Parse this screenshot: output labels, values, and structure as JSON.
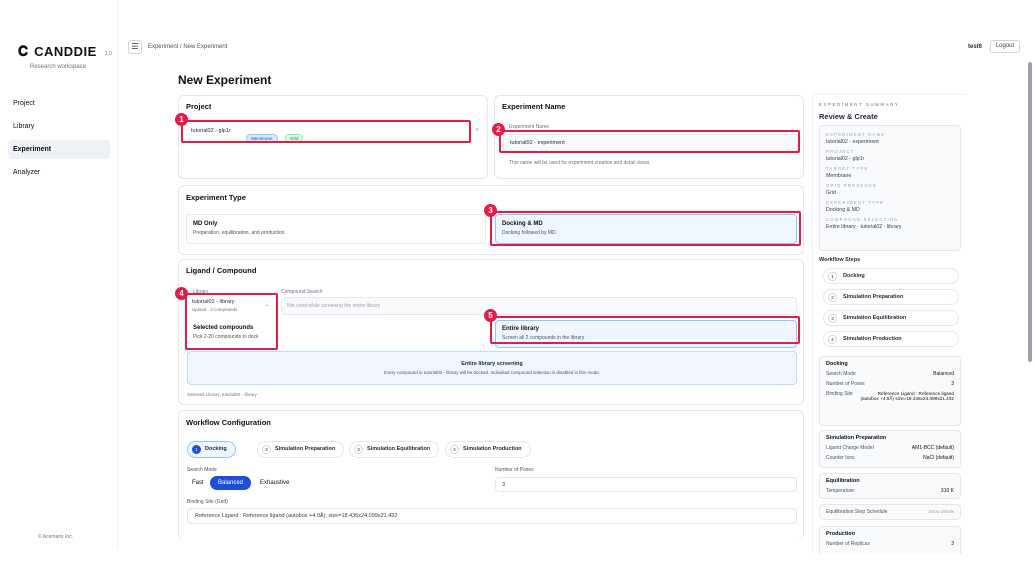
{
  "brand": {
    "name": "CANDDIE",
    "version": "2.0",
    "workspace": "Research workspace",
    "logo_icon": "c-logo-icon"
  },
  "nav": {
    "items": [
      {
        "label": "Project",
        "active": false
      },
      {
        "label": "Library",
        "active": false
      },
      {
        "label": "Experiment",
        "active": true
      },
      {
        "label": "Analyzer",
        "active": false
      }
    ]
  },
  "footer": {
    "copyright": "© Acemarix Inc."
  },
  "topbar": {
    "breadcrumb": "Experiment / New Experiment",
    "user": "test6",
    "logout": "Logout",
    "menu_icon": "hamburger-icon"
  },
  "page": {
    "title": "New Experiment"
  },
  "project": {
    "title": "Project",
    "value": "tutorial02 - glp1r",
    "tags": [
      "Membrane",
      "Grid"
    ],
    "clear_icon": "×"
  },
  "exp_name": {
    "title": "Experiment Name",
    "label": "Experiment Name",
    "value": "tutorial02 - experiment",
    "help": "This name will be used for experiment creation and detail views."
  },
  "exp_type": {
    "title": "Experiment Type",
    "options": [
      {
        "title": "MD Only",
        "desc": "Preparation, equilibration, and production."
      },
      {
        "title": "Docking & MD",
        "desc": "Docking followed by MD."
      }
    ]
  },
  "ligand": {
    "title": "Ligand / Compound",
    "library_label": "Library",
    "library_value": "tutorial02 - library",
    "library_sub": "Upload · 2 compounds",
    "search_label": "Compound Search",
    "search_placeholder": "Not used while screening the entire library",
    "options": [
      {
        "title": "Selected compounds",
        "desc": "Pick 2-20 compounds to dock"
      },
      {
        "title": "Entire library",
        "desc": "Screen all 2 compounds in the library"
      }
    ],
    "banner_title": "Entire library screening",
    "banner_desc": "Every compound in tutorial02 - library will be docked. Individual compound selection is disabled in this mode.",
    "selected_library": "Selected Library: tutorial02 - library"
  },
  "workflow": {
    "title": "Workflow Configuration",
    "steps": [
      {
        "num": "1",
        "label": "Docking"
      },
      {
        "num": "2",
        "label": "Simulation Preparation"
      },
      {
        "num": "3",
        "label": "Simulation Equilibration"
      },
      {
        "num": "4",
        "label": "Simulation Production"
      }
    ],
    "search_mode_label": "Search Mode",
    "modes": [
      "Fast",
      "Balanced",
      "Exhaustive"
    ],
    "poses_label": "Number of Poses",
    "poses_value": "3",
    "binding_label": "Binding Site (Grid)",
    "binding_value": "Reference Ligand : Reference ligand (autobox +4.0Å), size=18.436x24.099x21.432"
  },
  "annotations": [
    "1",
    "2",
    "3",
    "4",
    "5"
  ],
  "summary": {
    "head": "EXPERIMENT SUMMARY",
    "title": "Review & Create",
    "fields": [
      {
        "label": "EXPERIMENT NAME",
        "value": "tutorial02 - experiment"
      },
      {
        "label": "PROJECT",
        "value": "tutorial02 - glp1r"
      },
      {
        "label": "TARGET TYPE",
        "value": "Membrane"
      },
      {
        "label": "GRID PRESENCE",
        "value": "Grid"
      },
      {
        "label": "EXPERIMENT TYPE",
        "value": "Docking & MD"
      },
      {
        "label": "COMPOUND SELECTION",
        "value": "Entire library · tutorial02 - library"
      }
    ],
    "wf_head": "Workflow Steps",
    "wf_steps": [
      {
        "num": "1",
        "label": "Docking"
      },
      {
        "num": "2",
        "label": "Simulation Preparation"
      },
      {
        "num": "3",
        "label": "Simulation Equilibration"
      },
      {
        "num": "4",
        "label": "Simulation Production"
      }
    ],
    "docking": {
      "title": "Docking",
      "search_mode_k": "Search Mode",
      "search_mode_v": "Balanced",
      "poses_k": "Number of Poses",
      "poses_v": "3",
      "site_k": "Binding Site",
      "site_v": "Reference Ligand : Reference ligand (autobox +4.0Å) size=18.436x24.099x21.432"
    },
    "prep": {
      "title": "Simulation Preparation",
      "charge_k": "Ligand Charge Model",
      "charge_v": "AM1-BCC (default)",
      "ions_k": "Counter Ions",
      "ions_v": "NaCl (default)"
    },
    "equil": {
      "title": "Equilibration",
      "temp_k": "Temperature",
      "temp_v": "310 K"
    },
    "sched": {
      "label": "Equilibration Step Schedule",
      "action": "Show details"
    },
    "prod": {
      "title": "Production",
      "poses_k": "Number of Replicas",
      "poses_v": "3"
    }
  },
  "colors": {
    "accent": "#1d4ed8",
    "annotation": "#e11d48"
  }
}
